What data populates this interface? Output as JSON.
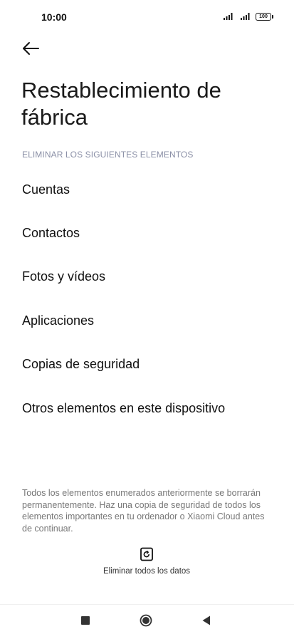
{
  "status_bar": {
    "time": "10:00",
    "battery": "100"
  },
  "header": {
    "back_icon": "arrow-left-icon",
    "title": "Restablecimiento de fábrica"
  },
  "section": {
    "header": "ELIMINAR LOS SIGUIENTES ELEMENTOS",
    "items": [
      {
        "label": "Cuentas"
      },
      {
        "label": "Contactos"
      },
      {
        "label": "Fotos y vídeos"
      },
      {
        "label": "Aplicaciones"
      },
      {
        "label": "Copias de seguridad"
      },
      {
        "label": "Otros elementos en este dispositivo"
      }
    ]
  },
  "disclaimer": "Todos los elementos enumerados anteriormente se borrarán permanentemente. Haz una copia de seguridad de todos los elementos importantes en tu ordenador o Xiaomi Cloud antes de continuar.",
  "action": {
    "icon": "reset-phone-icon",
    "label": "Eliminar todos los datos"
  },
  "nav_bar": {
    "recents_icon": "square-icon",
    "home_icon": "circle-icon",
    "back_icon": "triangle-back-icon"
  },
  "colors": {
    "section_header": "#8a8fa6",
    "disclaimer": "#777777",
    "text": "#111111"
  }
}
